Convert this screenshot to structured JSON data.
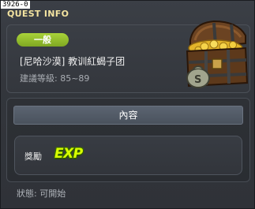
{
  "window": {
    "quest_id": "3926-0",
    "title": "QUEST INFO"
  },
  "header": {
    "category_badge": "一般",
    "quest_name": "[尼哈沙漠] 教训紅蝎子团",
    "recommended_level": "建議等級: 85~89"
  },
  "content": {
    "tab_label": "內容",
    "reward_label": "獎勵",
    "reward_icon_text": "EXP"
  },
  "footer": {
    "status": "狀態:  可開始"
  },
  "colors": {
    "badge": "#95c22c",
    "title": "#f3e3a0",
    "exp": "#d8ff00"
  },
  "icons": [
    "treasure-chest-icon",
    "exp-icon"
  ]
}
